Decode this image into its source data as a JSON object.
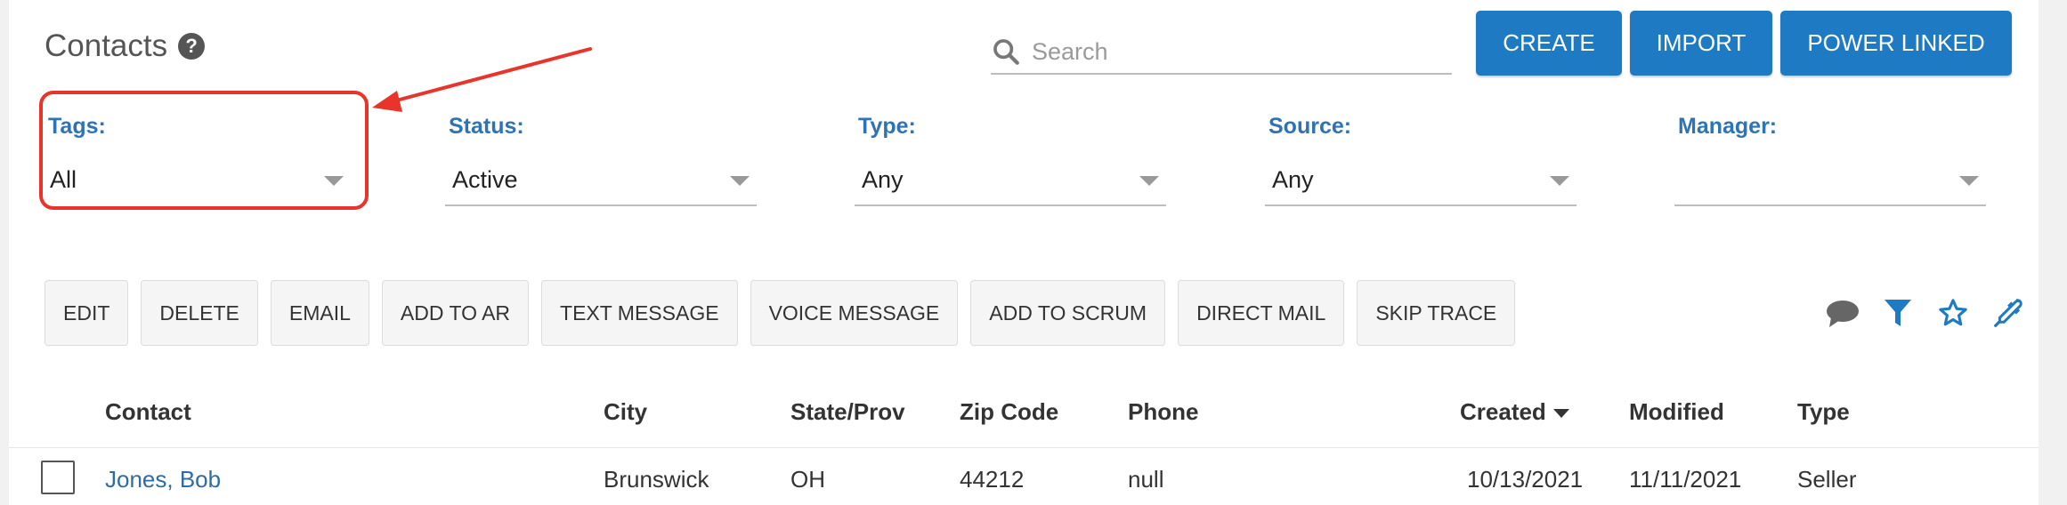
{
  "header": {
    "title": "Contacts",
    "help": "?",
    "search_placeholder": "Search",
    "buttons": {
      "create": "CREATE",
      "import": "IMPORT",
      "power_linked": "POWER LINKED"
    }
  },
  "filters": {
    "tags": {
      "label": "Tags:",
      "value": "All"
    },
    "status": {
      "label": "Status:",
      "value": "Active"
    },
    "type": {
      "label": "Type:",
      "value": "Any"
    },
    "source": {
      "label": "Source:",
      "value": "Any"
    },
    "manager": {
      "label": "Manager:",
      "value": ""
    }
  },
  "actions": {
    "edit": "EDIT",
    "delete": "DELETE",
    "email": "EMAIL",
    "add_to_ar": "ADD TO AR",
    "text_message": "TEXT MESSAGE",
    "voice_message": "VOICE MESSAGE",
    "add_to_scrum": "ADD TO SCRUM",
    "direct_mail": "DIRECT MAIL",
    "skip_trace": "SKIP TRACE"
  },
  "toolbar_icons": [
    "comment-icon",
    "filter-icon",
    "star-icon",
    "eyedropper-icon"
  ],
  "table": {
    "columns": {
      "contact": "Contact",
      "city": "City",
      "state": "State/Prov",
      "zip": "Zip Code",
      "phone": "Phone",
      "created": "Created",
      "modified": "Modified",
      "type": "Type"
    },
    "rows": [
      {
        "contact": "Jones, Bob",
        "city": "Brunswick",
        "state": "OH",
        "zip": "44212",
        "phone": "null",
        "created": "10/13/2021",
        "modified": "11/11/2021",
        "type": "Seller"
      }
    ]
  },
  "colors": {
    "primary": "#1f7ac4",
    "label_blue": "#2e74b5",
    "annotation_red": "#e8342a"
  }
}
